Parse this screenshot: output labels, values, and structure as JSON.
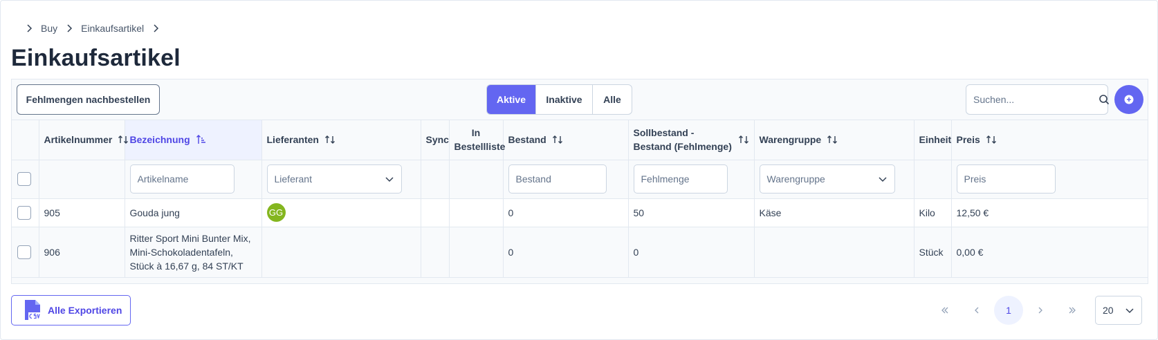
{
  "breadcrumb": [
    "Buy",
    "Einkaufsartikel"
  ],
  "page_title": "Einkaufsartikel",
  "toolbar": {
    "reorder_label": "Fehlmengen nachbestellen",
    "filters": [
      {
        "label": "Aktive",
        "active": true
      },
      {
        "label": "Inaktive",
        "active": false
      },
      {
        "label": "Alle",
        "active": false
      }
    ],
    "search_placeholder": "Suchen..."
  },
  "columns": [
    {
      "key": "artikelnummer",
      "label": "Artikelnummer",
      "sortable": true
    },
    {
      "key": "bezeichnung",
      "label": "Bezeichnung",
      "sortable": true,
      "sorted": "asc"
    },
    {
      "key": "lieferanten",
      "label": "Lieferanten",
      "sortable": true
    },
    {
      "key": "sync",
      "label": "Sync",
      "sortable": false
    },
    {
      "key": "bestellliste",
      "label": "In Bestellliste",
      "sortable": false
    },
    {
      "key": "bestand",
      "label": "Bestand",
      "sortable": true
    },
    {
      "key": "fehlmenge",
      "label": "Sollbestand - Bestand (Fehlmenge)",
      "sortable": true
    },
    {
      "key": "warengruppe",
      "label": "Warengruppe",
      "sortable": true
    },
    {
      "key": "einheit",
      "label": "Einheit",
      "sortable": false
    },
    {
      "key": "preis",
      "label": "Preis",
      "sortable": true
    }
  ],
  "filter_placeholders": {
    "artikelname": "Artikelname",
    "lieferant": "Lieferant",
    "bestand": "Bestand",
    "fehlmenge": "Fehlmenge",
    "warengruppe": "Warengruppe",
    "preis": "Preis"
  },
  "rows": [
    {
      "artikelnummer": "905",
      "bezeichnung": "Gouda jung",
      "lieferant_avatar": "GG",
      "bestand": "0",
      "fehlmenge": "50",
      "warengruppe": "Käse",
      "einheit": "Kilo",
      "preis": "12,50 €"
    },
    {
      "artikelnummer": "906",
      "bezeichnung": "Ritter Sport Mini Bunter Mix, Mini-Schokoladentafeln, Stück à 16,67 g, 84 ST/KT",
      "lieferant_avatar": "",
      "bestand": "0",
      "fehlmenge": "0",
      "warengruppe": "",
      "einheit": "Stück",
      "preis": "0,00 €"
    }
  ],
  "footer": {
    "export_label": "Alle Exportieren",
    "export_icon": "csv-file-icon",
    "current_page": "1",
    "per_page": "20"
  },
  "colors": {
    "accent": "#6366f1",
    "avatar_bg": "#84b61f"
  }
}
